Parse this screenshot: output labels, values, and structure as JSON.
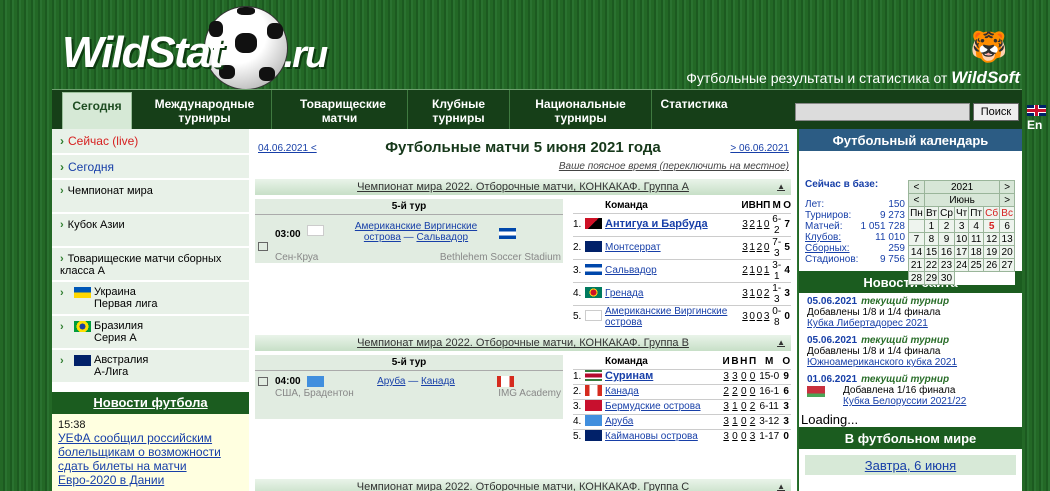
{
  "header": {
    "logo_left": "WildStat",
    "logo_right": ".ru",
    "tagline": "Футбольные результаты и статистика от",
    "brand": "WildSoft"
  },
  "nav": {
    "tabs": [
      {
        "label": "Сегодня"
      },
      {
        "label": "Международные турниры"
      },
      {
        "label": "Товарищеские матчи"
      },
      {
        "label": "Клубные турниры"
      },
      {
        "label": "Национальные турниры"
      },
      {
        "label": "Статистика"
      }
    ],
    "search_button": "Поиск",
    "search_value": "",
    "lang": "En"
  },
  "sidebar": {
    "items": [
      {
        "label": "Сейчас (live)"
      },
      {
        "label": "Сегодня"
      },
      {
        "label": "Чемпионат мира"
      },
      {
        "label": "Кубок Азии"
      },
      {
        "label": "Товарищеские матчи сборных класса A"
      },
      {
        "label": "Украина",
        "sub": "Первая лига"
      },
      {
        "label": "Бразилия",
        "sub": "Серия A"
      },
      {
        "label": "Австралия",
        "sub": "A-Лига"
      }
    ],
    "news_title": "Новости футбола",
    "news_time": "15:38",
    "news_text": "УЕФА сообщил российским болельщикам о возможности сдать билеты на матчи Евро-2020 в Дании"
  },
  "main": {
    "prev_date": "04.06.2021 <",
    "next_date": "> 06.06.2021",
    "title": "Футбольные матчи 5 июня 2021 года",
    "timezone": "Ваше поясное время (переключить на местное)",
    "groups": [
      {
        "title": "Чемпионат мира 2022. Отборочные матчи, КОНКАКАФ. Группа A",
        "round": "5-й тур",
        "time": "03:00",
        "home": "Американские Виргинские острова",
        "away": "Сальвадор",
        "place": "Сен-Круа",
        "stadium": "Bethlehem Soccer Stadium",
        "standings_header": [
          "Команда",
          "И",
          "В",
          "Н",
          "П",
          "М",
          "О"
        ],
        "standings": [
          {
            "pos": "1.",
            "team": "Антигуа и Барбуда",
            "p": "3",
            "w": "2",
            "d": "1",
            "l": "0",
            "gd": "6-2",
            "pts": "7"
          },
          {
            "pos": "2.",
            "team": "Монтсеррат",
            "p": "3",
            "w": "1",
            "d": "2",
            "l": "0",
            "gd": "7-3",
            "pts": "5"
          },
          {
            "pos": "3.",
            "team": "Сальвадор",
            "p": "2",
            "w": "1",
            "d": "0",
            "l": "1",
            "gd": "3-1",
            "pts": "4"
          },
          {
            "pos": "4.",
            "team": "Гренада",
            "p": "3",
            "w": "1",
            "d": "0",
            "l": "2",
            "gd": "1-3",
            "pts": "3"
          },
          {
            "pos": "5.",
            "team": "Американские Виргинские острова",
            "p": "3",
            "w": "0",
            "d": "0",
            "l": "3",
            "gd": "0-8",
            "pts": "0"
          }
        ]
      },
      {
        "title": "Чемпионат мира 2022. Отборочные матчи, КОНКАКАФ. Группа B",
        "round": "5-й тур",
        "time": "04:00",
        "home": "Аруба",
        "away": "Канада",
        "place": "США, Брадентон",
        "stadium": "IMG Academy",
        "standings_header": [
          "Команда",
          "И",
          "В",
          "Н",
          "П",
          "М",
          "О"
        ],
        "standings": [
          {
            "pos": "1.",
            "team": "Суринам",
            "p": "3",
            "w": "3",
            "d": "0",
            "l": "0",
            "gd": "15-0",
            "pts": "9"
          },
          {
            "pos": "2.",
            "team": "Канада",
            "p": "2",
            "w": "2",
            "d": "0",
            "l": "0",
            "gd": "16-1",
            "pts": "6"
          },
          {
            "pos": "3.",
            "team": "Бермудские острова",
            "p": "3",
            "w": "1",
            "d": "0",
            "l": "2",
            "gd": "6-11",
            "pts": "3"
          },
          {
            "pos": "4.",
            "team": "Аруба",
            "p": "3",
            "w": "1",
            "d": "0",
            "l": "2",
            "gd": "3-12",
            "pts": "3"
          },
          {
            "pos": "5.",
            "team": "Каймановы острова",
            "p": "3",
            "w": "0",
            "d": "0",
            "l": "3",
            "gd": "1-17",
            "pts": "0"
          }
        ]
      },
      {
        "title": "Чемпионат мира 2022. Отборочные матчи, КОНКАКАФ. Группа C"
      }
    ]
  },
  "right": {
    "calendar_title": "Футбольный календарь",
    "db_title": "Сейчас в базе:",
    "db": [
      {
        "label": "Лет:",
        "value": "150"
      },
      {
        "label": "Турниров:",
        "value": "9 273"
      },
      {
        "label": "Матчей:",
        "value": "1 051 728"
      },
      {
        "label": "Клубов:",
        "value": "11 010"
      },
      {
        "label": "Сборных:",
        "value": "259"
      },
      {
        "label": "Стадионов:",
        "value": "9 756"
      }
    ],
    "year": "2021",
    "month": "Июнь",
    "weekdays": [
      "Пн",
      "Вт",
      "Ср",
      "Чт",
      "Пт",
      "Сб",
      "Вс"
    ],
    "weeks": [
      [
        "",
        "1",
        "2",
        "3",
        "4",
        "5",
        "6"
      ],
      [
        "7",
        "8",
        "9",
        "10",
        "11",
        "12",
        "13"
      ],
      [
        "14",
        "15",
        "16",
        "17",
        "18",
        "19",
        "20"
      ],
      [
        "21",
        "22",
        "23",
        "24",
        "25",
        "26",
        "27"
      ],
      [
        "28",
        "29",
        "30",
        "",
        "",
        "",
        ""
      ]
    ],
    "site_news_title": "Новости сайта",
    "updates": [
      {
        "date": "05.06.2021",
        "tag": "текущий турнир",
        "text": "Добавлены 1/8 и 1/4 финала",
        "link": "Кубка Либертадорес 2021"
      },
      {
        "date": "05.06.2021",
        "tag": "текущий турнир",
        "text": "Добавлены 1/8 и 1/4 финала",
        "link": "Южноамериканского кубка 2021"
      },
      {
        "date": "01.06.2021",
        "tag": "текущий турнир",
        "text": "Добавлена 1/16 финала",
        "link": "Кубка Белоруссии 2021/22"
      }
    ],
    "loading": "Loading...",
    "world_title": "В футбольном мире",
    "tomorrow": "Завтра, 6 июня"
  }
}
